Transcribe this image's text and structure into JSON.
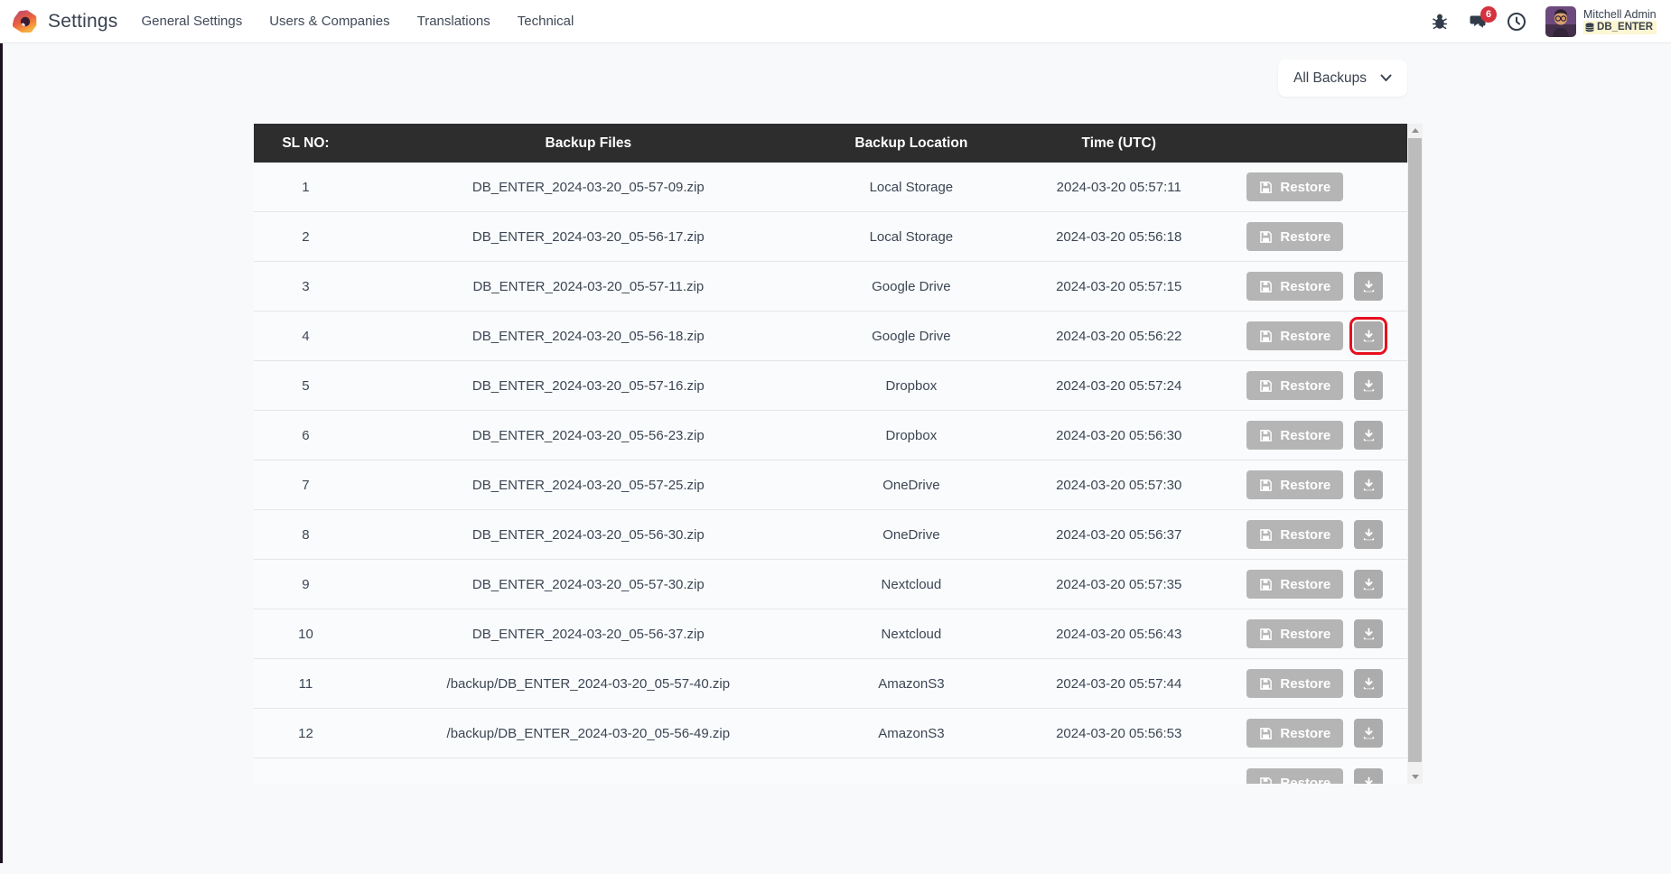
{
  "navbar": {
    "app_title": "Settings",
    "menu_items": [
      "General Settings",
      "Users & Companies",
      "Translations",
      "Technical"
    ],
    "message_badge": "6",
    "user_name": "Mitchell Admin",
    "database_name": "DB_ENTER"
  },
  "filter": {
    "label": "All Backups"
  },
  "table": {
    "headers": [
      "SL NO:",
      "Backup Files",
      "Backup Location",
      "Time (UTC)"
    ],
    "restore_label": "Restore",
    "rows": [
      {
        "sl": "1",
        "file": "DB_ENTER_2024-03-20_05-57-09.zip",
        "location": "Local Storage",
        "time": "2024-03-20 05:57:11",
        "download": false,
        "highlight": false
      },
      {
        "sl": "2",
        "file": "DB_ENTER_2024-03-20_05-56-17.zip",
        "location": "Local Storage",
        "time": "2024-03-20 05:56:18",
        "download": false,
        "highlight": false
      },
      {
        "sl": "3",
        "file": "DB_ENTER_2024-03-20_05-57-11.zip",
        "location": "Google Drive",
        "time": "2024-03-20 05:57:15",
        "download": true,
        "highlight": false
      },
      {
        "sl": "4",
        "file": "DB_ENTER_2024-03-20_05-56-18.zip",
        "location": "Google Drive",
        "time": "2024-03-20 05:56:22",
        "download": true,
        "highlight": true
      },
      {
        "sl": "5",
        "file": "DB_ENTER_2024-03-20_05-57-16.zip",
        "location": "Dropbox",
        "time": "2024-03-20 05:57:24",
        "download": true,
        "highlight": false
      },
      {
        "sl": "6",
        "file": "DB_ENTER_2024-03-20_05-56-23.zip",
        "location": "Dropbox",
        "time": "2024-03-20 05:56:30",
        "download": true,
        "highlight": false
      },
      {
        "sl": "7",
        "file": "DB_ENTER_2024-03-20_05-57-25.zip",
        "location": "OneDrive",
        "time": "2024-03-20 05:57:30",
        "download": true,
        "highlight": false
      },
      {
        "sl": "8",
        "file": "DB_ENTER_2024-03-20_05-56-30.zip",
        "location": "OneDrive",
        "time": "2024-03-20 05:56:37",
        "download": true,
        "highlight": false
      },
      {
        "sl": "9",
        "file": "DB_ENTER_2024-03-20_05-57-30.zip",
        "location": "Nextcloud",
        "time": "2024-03-20 05:57:35",
        "download": true,
        "highlight": false
      },
      {
        "sl": "10",
        "file": "DB_ENTER_2024-03-20_05-56-37.zip",
        "location": "Nextcloud",
        "time": "2024-03-20 05:56:43",
        "download": true,
        "highlight": false
      },
      {
        "sl": "11",
        "file": "/backup/DB_ENTER_2024-03-20_05-57-40.zip",
        "location": "AmazonS3",
        "time": "2024-03-20 05:57:44",
        "download": true,
        "highlight": false
      },
      {
        "sl": "12",
        "file": "/backup/DB_ENTER_2024-03-20_05-56-49.zip",
        "location": "AmazonS3",
        "time": "2024-03-20 05:56:53",
        "download": true,
        "highlight": false
      },
      {
        "sl": "",
        "file": "",
        "location": "",
        "time": "",
        "download": true,
        "highlight": false
      }
    ]
  },
  "colors": {
    "header_bg": "#2d2d2d",
    "button_gray": "#b5b5b5",
    "highlight_red": "#e6101e",
    "badge_red": "#d4323e",
    "db_chip_bg": "#fcf6d2",
    "page_bg": "#f8f9fb"
  }
}
